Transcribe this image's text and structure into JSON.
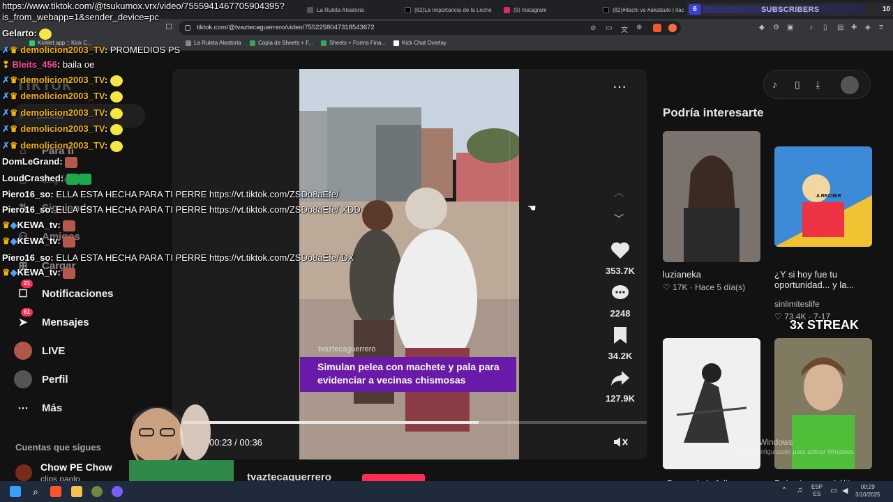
{
  "browser": {
    "stream_url_overlay": "https://www.tiktok.com/@tsukumox.vrx/video/7555941467705904395?is_from_webapp=1&sender_device=pc",
    "tabs": [
      {
        "label": "La Ruleta Aleatoria"
      },
      {
        "label": "(82)La Importancia de la Leche"
      },
      {
        "label": "(9) Instagram"
      },
      {
        "label": "(82)#itachi vs #akatsuki | itac"
      }
    ],
    "address": "tiktok.com/@tvaztecaguerrero/video/7552258047318543672",
    "bookmarks": [
      {
        "label": "Kicklet.app :: Kick C..."
      },
      {
        "label": "La Ruleta Aleatoria"
      },
      {
        "label": "Copia de Sheets + F..."
      },
      {
        "label": "Sheets + Forms Fina..."
      },
      {
        "label": "Kick Chat Overlay"
      }
    ]
  },
  "subscriber_widget": {
    "left_count": "6",
    "label": "SUBSCRIBERS",
    "right_count": "10"
  },
  "sidebar": {
    "logo": "TikTok",
    "search_placeholder": "Buscar",
    "items": [
      {
        "label": "Para ti"
      },
      {
        "label": "Explorar"
      },
      {
        "label": "Siguiendo"
      },
      {
        "label": "Amigos"
      },
      {
        "label": "Cargar"
      },
      {
        "label": "Notificaciones",
        "badge": "21"
      },
      {
        "label": "Mensajes",
        "badge": "61"
      },
      {
        "label": "LIVE"
      },
      {
        "label": "Perfil"
      },
      {
        "label": "Más"
      }
    ],
    "following_title": "Cuentas que sigues",
    "following": [
      {
        "name": "Chow PE Chow",
        "sub": "clips paolo"
      }
    ]
  },
  "video": {
    "caption": "Simulan pelea con machete y pala para evidenciar a vecinas chismosas",
    "watermark": "tvaztecaguerrero",
    "time": "00:23 / 00:36",
    "progress_fraction": 0.639,
    "author_partial": "tvaztecaguerrero",
    "actions": [
      {
        "name": "like",
        "count": "353.7K"
      },
      {
        "name": "comment",
        "count": "2248"
      },
      {
        "name": "save",
        "count": "34.2K"
      },
      {
        "name": "share",
        "count": "127.9K"
      }
    ]
  },
  "recommendations": {
    "title": "Podría interesarte",
    "cards": [
      {
        "name": "luzianeka",
        "likes": "17K",
        "when": "Hace 5 día(s)"
      },
      {
        "name": "¿Y si hoy fue tu oportunidad... y la...",
        "user": "sinlimiteslife",
        "likes": "73.4K",
        "when": "7-17",
        "overlay": "3x STREAK",
        "banner": "A RECIBIR"
      },
      {
        "name": "Desearía la folla..."
      },
      {
        "name": "Deberías ver el último..."
      }
    ],
    "windows_watermark": "Windows",
    "windows_watermark_sub": "Ve a Configuración para activar Windows."
  },
  "chat": [
    {
      "user": "Gelarto",
      "color": "#ffffff",
      "msg": ""
    },
    {
      "user": "demolicion2003_TV",
      "color": "#f4b400",
      "msg": "PROMEDIOS PS"
    },
    {
      "user": "Bleits_456",
      "color": "#ff4fa3",
      "msg": "baila oe"
    },
    {
      "user": "demolicion2003_TV",
      "color": "#f4b400",
      "msg": ""
    },
    {
      "user": "demolicion2003_TV",
      "color": "#f4b400",
      "msg": ""
    },
    {
      "user": "demolicion2003_TV",
      "color": "#f4b400",
      "msg": ""
    },
    {
      "user": "demolicion2003_TV",
      "color": "#f4b400",
      "msg": ""
    },
    {
      "user": "demolicion2003_TV",
      "color": "#f4b400",
      "msg": ""
    },
    {
      "user": "DomLeGrand",
      "color": "#ffffff",
      "msg": ""
    },
    {
      "user": "LoudCrashed",
      "color": "#ffffff",
      "msg": ""
    },
    {
      "user": "Piero16_so",
      "color": "#ffffff",
      "msg": "ELLA ESTA HECHA PARA TI PERRE https://vt.tiktok.com/ZSDo8aEfe/"
    },
    {
      "user": "Piero16_so",
      "color": "#ffffff",
      "msg": "ELLA ESTA HECHA PARA TI PERRE https://vt.tiktok.com/ZSDo8aEfe/ XDD"
    },
    {
      "user": "KEWA_tv",
      "color": "#ffffff",
      "msg": ""
    },
    {
      "user": "KEWA_tv",
      "color": "#ffffff",
      "msg": ""
    },
    {
      "user": "Piero16_so",
      "color": "#ffffff",
      "msg": "ELLA ESTA HECHA PARA TI PERRE https://vt.tiktok.com/ZSDo8aEfe/ DX"
    },
    {
      "user": "KEWA_tv",
      "color": "#ffffff",
      "msg": ""
    }
  ],
  "taskbar": {
    "lang": "ESP",
    "lang_sub": "ES",
    "time": "00:29",
    "date": "3/10/2025"
  },
  "colors": {
    "accent": "#fe2c55",
    "caption_bg": "#6a1aa8",
    "chat_gold": "#f4b400"
  }
}
